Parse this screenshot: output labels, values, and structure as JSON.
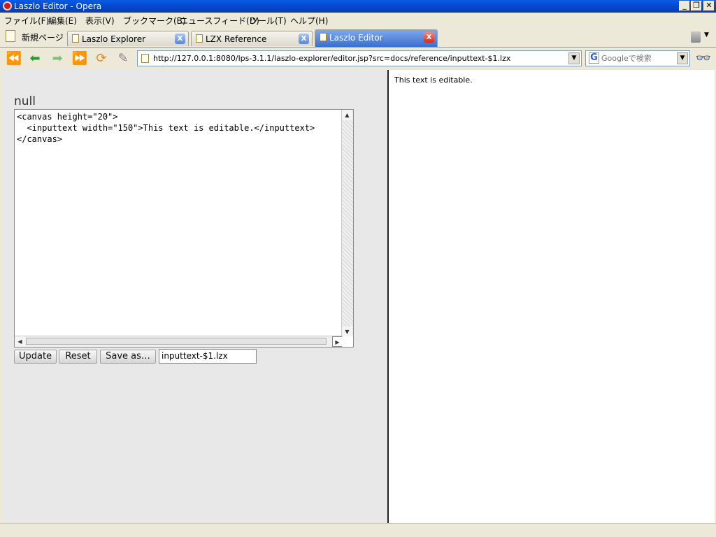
{
  "window": {
    "title": "Laszlo Editor - Opera"
  },
  "menu": [
    {
      "label": "ファイル(F)"
    },
    {
      "label": "編集(E)"
    },
    {
      "label": "表示(V)"
    },
    {
      "label": "ブックマーク(B)"
    },
    {
      "label": "ニュースフィード(D)"
    },
    {
      "label": "ツール(T)"
    },
    {
      "label": "ヘルプ(H)"
    }
  ],
  "tabs": {
    "new_page": "新規ページ",
    "items": [
      {
        "label": "Laszlo Explorer",
        "active": false
      },
      {
        "label": "LZX Reference",
        "active": false
      },
      {
        "label": "Laszlo Editor",
        "active": true
      }
    ]
  },
  "address": {
    "url": "http://127.0.0.1:8080/lps-3.1.1/laszlo-explorer/editor.jsp?src=docs/reference/inputtext-$1.lzx"
  },
  "search": {
    "placeholder": "Googleで検索"
  },
  "editor": {
    "heading": "null",
    "code": "<canvas height=\"20\">\n  <inputtext width=\"150\">This text is editable.</inputtext>\n</canvas>",
    "buttons": {
      "update": "Update",
      "reset": "Reset",
      "save_as": "Save as…"
    },
    "filename": "inputtext-$1.lzx"
  },
  "output": {
    "text": "This text is editable."
  }
}
